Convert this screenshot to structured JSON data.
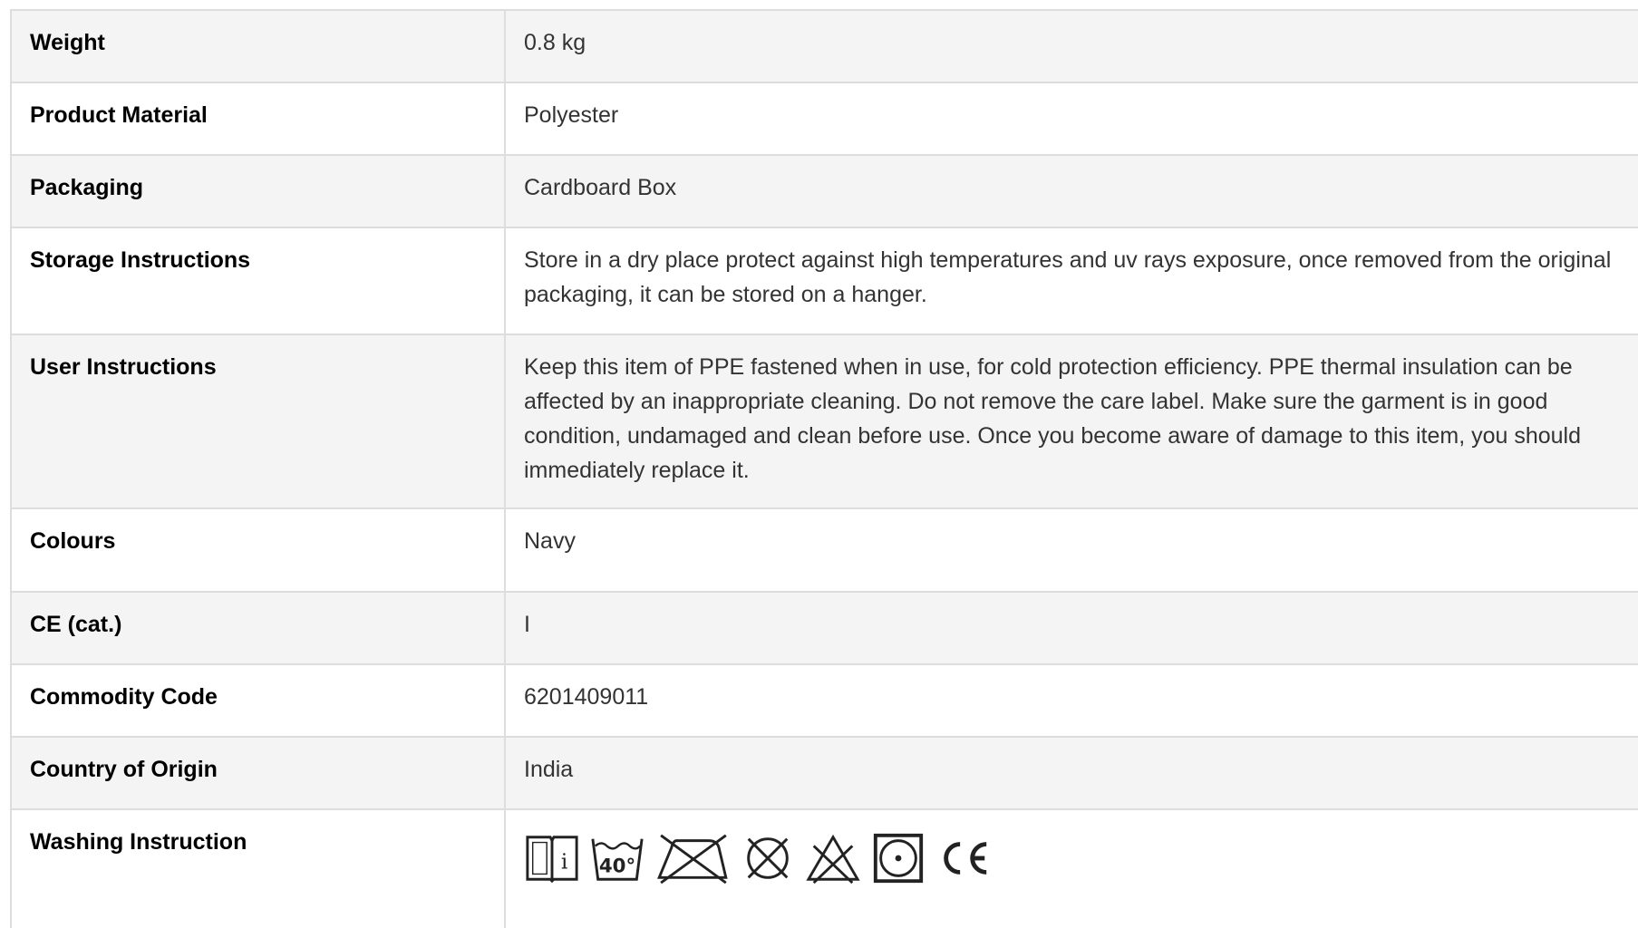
{
  "specs": {
    "rows": [
      {
        "label": "Weight",
        "value": "0.8 kg"
      },
      {
        "label": "Product Material",
        "value": "Polyester"
      },
      {
        "label": "Packaging",
        "value": "Cardboard Box"
      },
      {
        "label": "Storage Instructions",
        "value": "Store in a dry place protect against high temperatures and uv rays exposure, once removed from the original packaging, it can be stored on a hanger."
      },
      {
        "label": "User Instructions",
        "value": "Keep this item of PPE fastened when in use, for cold protection efficiency. PPE thermal insulation can be affected by an inappropriate cleaning. Do not remove the care label. Make sure the garment is in good condition, undamaged and clean before use. Once you become aware of damage to this item, you should immediately replace it."
      },
      {
        "label": "Colours",
        "value": "Navy"
      },
      {
        "label": "CE (cat.)",
        "value": "I"
      },
      {
        "label": "Commodity Code",
        "value": "6201409011"
      },
      {
        "label": "Country of Origin",
        "value": "India"
      },
      {
        "label": "Washing Instruction",
        "value": ""
      }
    ]
  },
  "washing_icons": {
    "read_instructions": "i",
    "wash_temperature": "40°",
    "names": [
      "book-info-icon",
      "wash-40-icon",
      "do-not-iron-icon",
      "do-not-dry-clean-icon",
      "do-not-bleach-icon",
      "tumble-dry-icon",
      "ce-mark-icon"
    ]
  },
  "colors": {
    "odd_row_bg": "#f4f4f4",
    "even_row_bg": "#ffffff",
    "border": "#dddddd",
    "label_text": "#000000",
    "value_text": "#333333"
  }
}
